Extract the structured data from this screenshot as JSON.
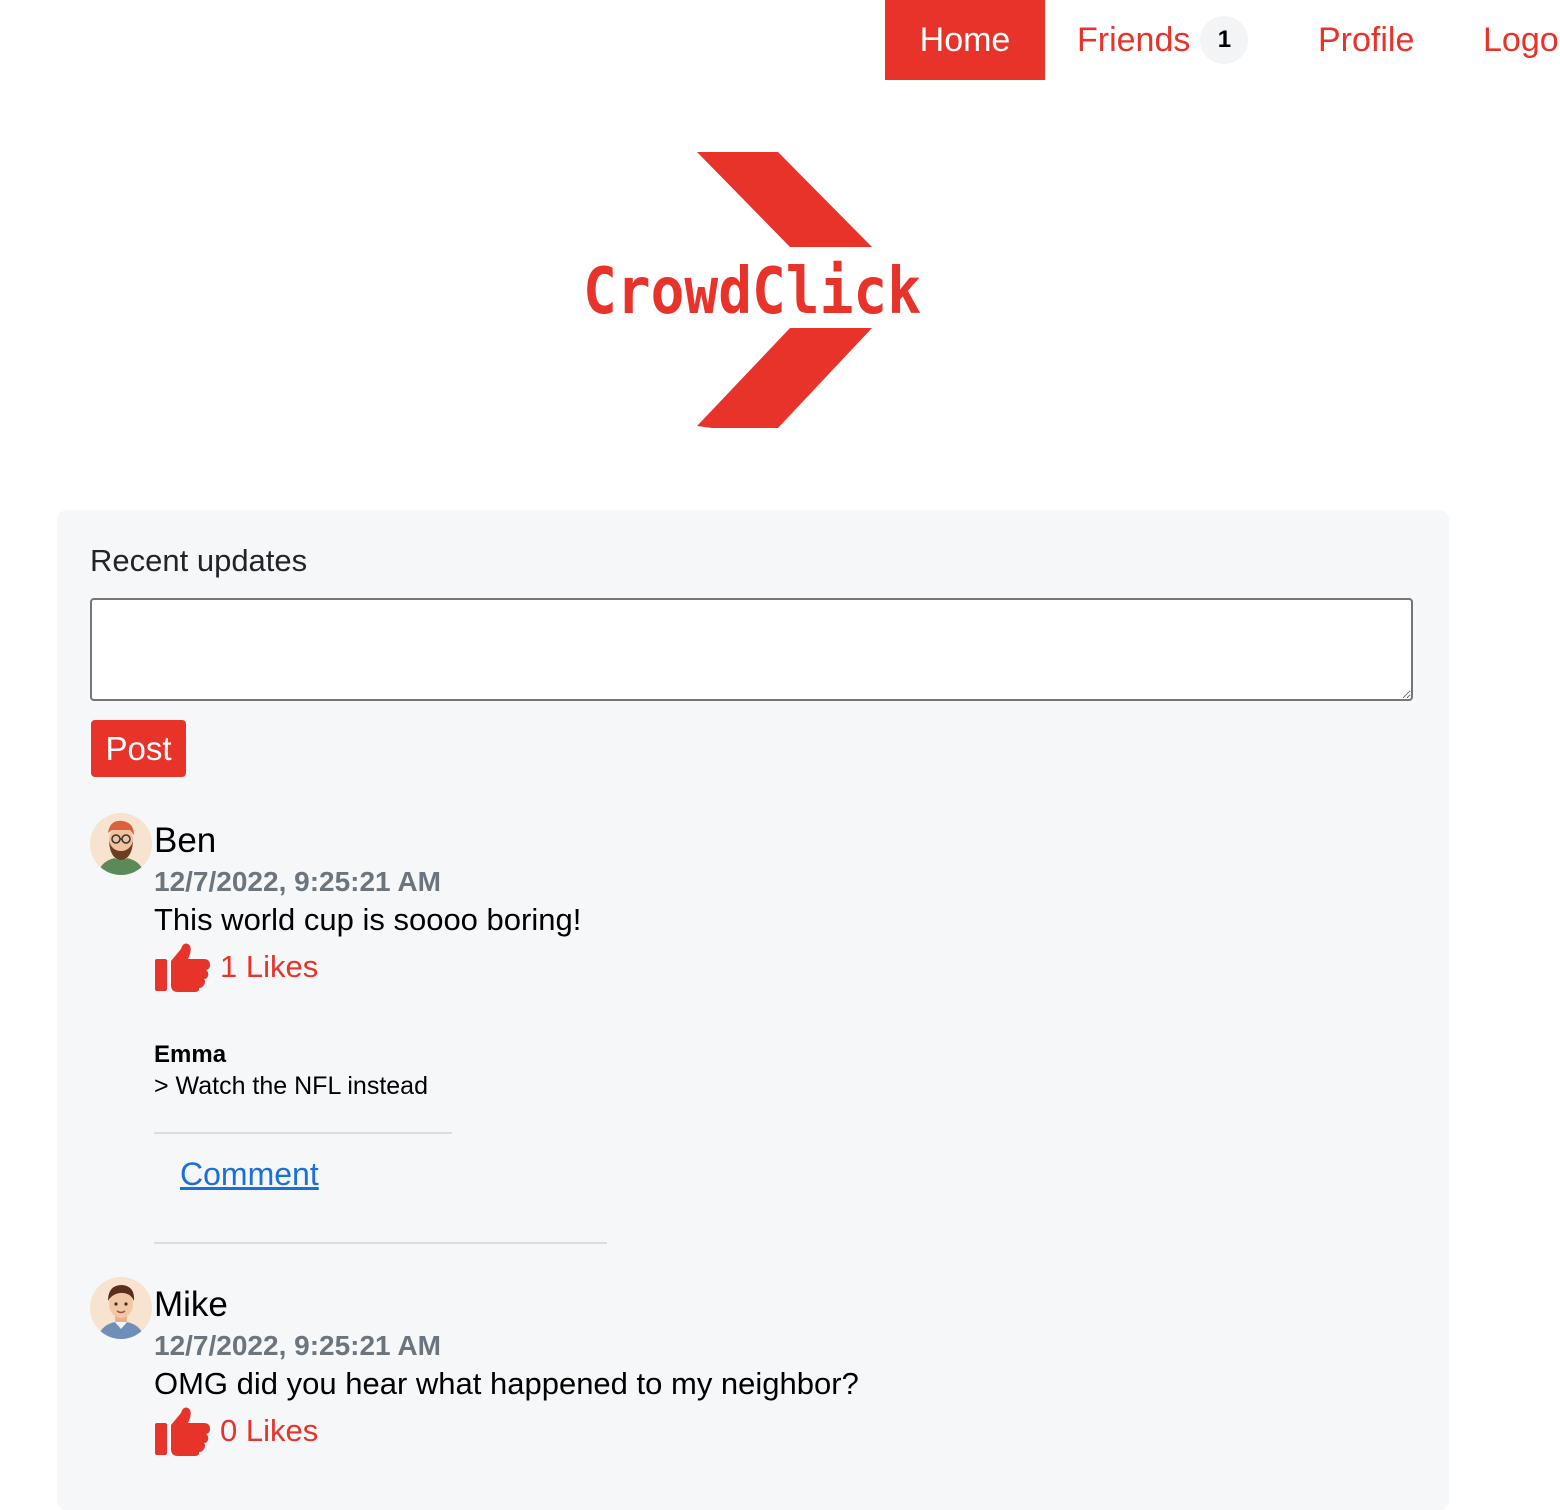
{
  "nav": {
    "home": "Home",
    "friends": "Friends",
    "friends_badge": "1",
    "profile": "Profile",
    "logout": "Logo"
  },
  "logo": {
    "text": "CrowdClick"
  },
  "feed": {
    "title": "Recent updates",
    "input_value": "",
    "post_button": "Post",
    "comment_link": "Comment"
  },
  "posts": [
    {
      "author": "Ben",
      "timestamp": "12/7/2022, 9:25:21 AM",
      "text": "This world cup is soooo boring!",
      "likes": "1 Likes",
      "comments": [
        {
          "author": "Emma",
          "text": "> Watch the NFL instead"
        }
      ]
    },
    {
      "author": "Mike",
      "timestamp": "12/7/2022, 9:25:21 AM",
      "text": "OMG did you hear what happened to my neighbor?",
      "likes": "0 Likes"
    }
  ],
  "colors": {
    "brand": "#e8332a",
    "card_bg": "#f6f7f9",
    "link": "#1a6fd8",
    "muted": "#6c757d"
  },
  "icons": {
    "like": "thumbs-up-icon"
  }
}
